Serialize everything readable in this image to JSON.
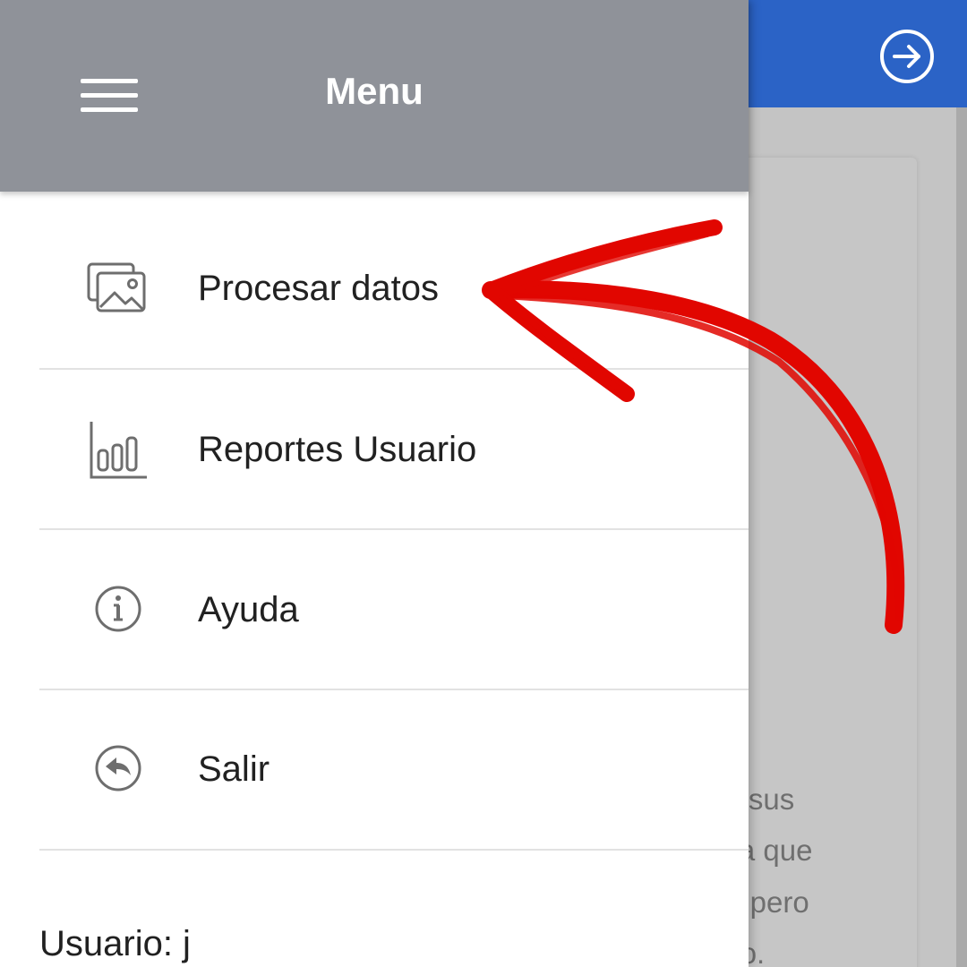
{
  "background_app": {
    "accent_color": "#2b63c6",
    "logout_icon": "arrow-right-circle-icon",
    "text_lines": [
      "ue sus",
      "n la que",
      "ro, pero",
      "npo."
    ]
  },
  "drawer": {
    "header_color": "#8f9299",
    "title": "Menu",
    "hamburger_icon": "hamburger-menu-icon",
    "items": [
      {
        "label": "Procesar datos",
        "icon": "images-icon"
      },
      {
        "label": "Reportes Usuario",
        "icon": "bar-chart-icon"
      },
      {
        "label": "Ayuda",
        "icon": "info-icon"
      },
      {
        "label": "Salir",
        "icon": "reply-icon"
      }
    ],
    "user_text": "Usuario: j"
  },
  "annotation": {
    "type": "hand-drawn-arrow",
    "color": "#e10600",
    "points_to": "Procesar datos"
  }
}
